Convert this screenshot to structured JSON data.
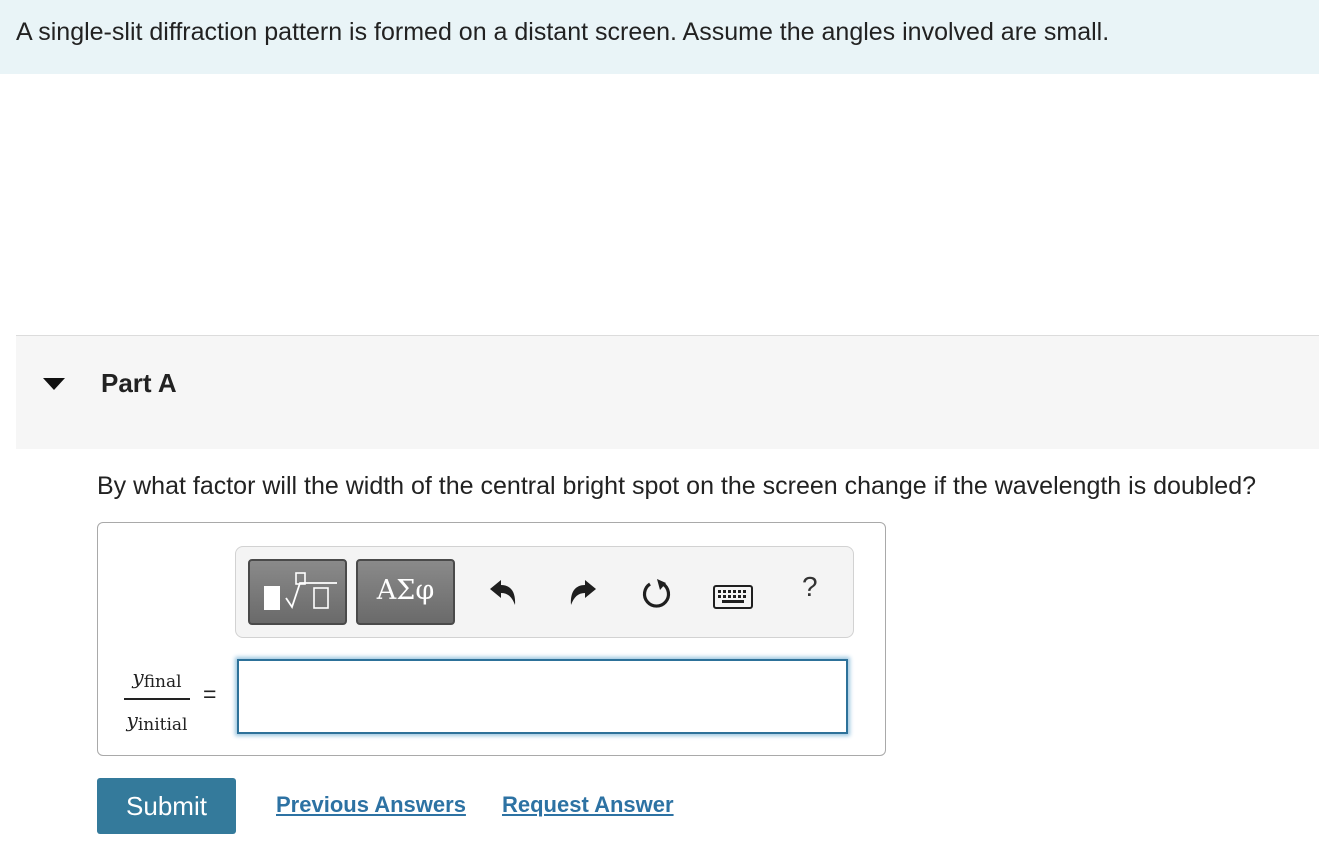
{
  "intro": {
    "text": "A single-slit diffraction pattern is formed on a distant screen. Assume the angles involved are small."
  },
  "part": {
    "title": "Part A",
    "question": "By what factor will the width of the central bright spot on the screen change if the wavelength is doubled?"
  },
  "toolbar": {
    "greek_label": "ΑΣφ",
    "help_label": "?",
    "icons": [
      "templates-icon",
      "greek-letters-icon",
      "undo-icon",
      "redo-icon",
      "reset-icon",
      "keyboard-icon",
      "help-icon"
    ]
  },
  "answer": {
    "numerator_var": "y",
    "numerator_sub": "final",
    "denominator_var": "y",
    "denominator_sub": "initial",
    "equals": "=",
    "value": ""
  },
  "actions": {
    "submit_label": "Submit",
    "previous_answers_label": "Previous Answers",
    "request_answer_label": "Request Answer"
  },
  "colors": {
    "intro_bg": "#e9f4f7",
    "part_header_bg": "#f6f6f6",
    "submit_bg": "#347a9b",
    "link": "#2d72a3",
    "input_border": "#2d7199"
  }
}
